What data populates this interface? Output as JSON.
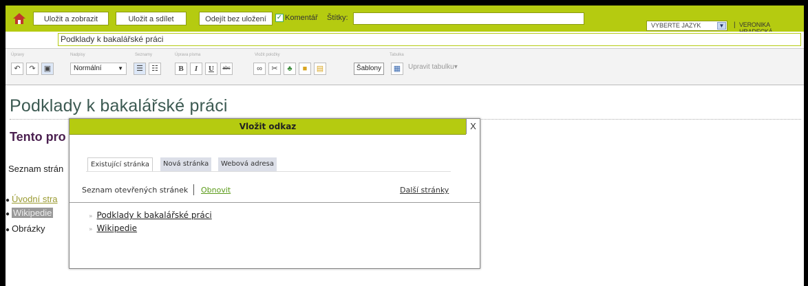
{
  "topbar": {
    "buttons": [
      "Uložit a zobrazit",
      "Uložit a sdílet",
      "Odejít bez uložení"
    ],
    "comment_label": "Komentář",
    "comment_checked": true,
    "tags_label": "Štítky:",
    "tags_value": "",
    "language_select": "VYBERTE JAZYK",
    "separator": "|",
    "user": "VERONIKA HRADECKÁ",
    "accent_color": "#b5cb10"
  },
  "page_title_value": "Podklady k bakalářské práci",
  "toolbar": {
    "groups": [
      "Úpravy",
      "Nadpisy",
      "Seznamy",
      "Úprava písma",
      "Vložit položky",
      "Tabulka"
    ],
    "format_select": "Normální",
    "sablony": "Šablony",
    "table_edit": "Upravit tabulku▾"
  },
  "content": {
    "heading": "Podklady k bakalářské práci",
    "subheading": "Tento pro",
    "list_intro": "Seznam strán",
    "items": [
      "Úvodní stra",
      "Wikipedie",
      "Obrázky"
    ]
  },
  "dialog": {
    "title": "Vložit odkaz",
    "close": "X",
    "tabs": [
      "Existující stránka",
      "Nová stránka",
      "Webová adresa"
    ],
    "open_pages_label": "Seznam otevřených stránek",
    "refresh": "Obnovit",
    "more_pages": "Další stránky",
    "pages": [
      "Podklady k bakalářské práci",
      "Wikipedie"
    ]
  }
}
